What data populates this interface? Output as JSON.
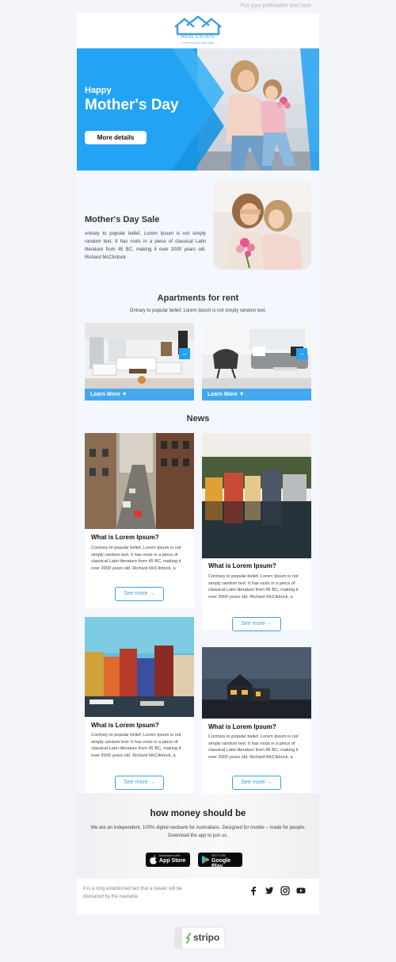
{
  "preheader": "Put your preheader text here",
  "logo": {
    "name": "REAL ESTATE",
    "tagline": "YOUR TAGLINE GOES HERE",
    "color": "#3aa0e3"
  },
  "hero": {
    "kicker": "Happy",
    "title": "Mother's Day",
    "button_label": "More details",
    "accent": "#23a3f3"
  },
  "sale": {
    "title": "Mother's Day Sale",
    "text": "ontrary to popular belief, Lorem Ipsum is not simply random text. It has roots in a piece of classical Latin literature from 45 BC, making it over 2000 years old. Richard McClintock"
  },
  "apartments": {
    "title": "Apartments for rent",
    "subtitle": "Ontrary to popular belief, Lorem Ipsum is not simply random text.",
    "items": [
      {
        "button_label": "Learn More ▼",
        "arrow": "→"
      },
      {
        "button_label": "Learn More ▼",
        "arrow": "→"
      }
    ]
  },
  "news": {
    "title": "News",
    "cards": [
      {
        "title": "What is Lorem Ipsum?",
        "text": "Contrary to popular belief, Lorem Ipsum is not simply random text. It has roots in a piece of classical Latin literature from 45 BC, making it over 2000 years old. Richard McClintock, a",
        "button_label": "See more →"
      },
      {
        "title": "What is Lorem Ipsum?",
        "text": "Contrary to popular belief, Lorem Ipsum is not simply random text. It has roots in a piece of classical Latin literature from 45 BC, making it over 2000 years old. Richard McClintock, a",
        "button_label": "See more →"
      },
      {
        "title": "What is Lorem Ipsum?",
        "text": "Contrary to popular belief, Lorem Ipsum is not simply random text. It has roots in a piece of classical Latin literature from 45 BC, making it over 2000 years old. Richard McClintock, a",
        "button_label": "See more →"
      },
      {
        "title": "What is Lorem Ipsum?",
        "text": "Contrary to popular belief, Lorem Ipsum is not simply random text. It has roots in a piece of classical Latin literature from 45 BC, making it over 2000 years old. Richard McClintock, a",
        "button_label": "See more →"
      }
    ]
  },
  "app": {
    "title": "how money should be",
    "text": "We are an independent, 100% digital neobank for Australians. Designed for mobile – made for people. Download the app to join us.",
    "appstore": {
      "small": "Download on the",
      "big": "App Store"
    },
    "googleplay": {
      "small": "GET IT ON",
      "big": "Google Play"
    }
  },
  "footer": {
    "text": "It is a long established fact that a reader will be distracted by the readable",
    "social": [
      "facebook-icon",
      "twitter-icon",
      "instagram-icon",
      "youtube-icon"
    ]
  },
  "badge": {
    "label": "stripo",
    "color": "#5cb85c"
  }
}
